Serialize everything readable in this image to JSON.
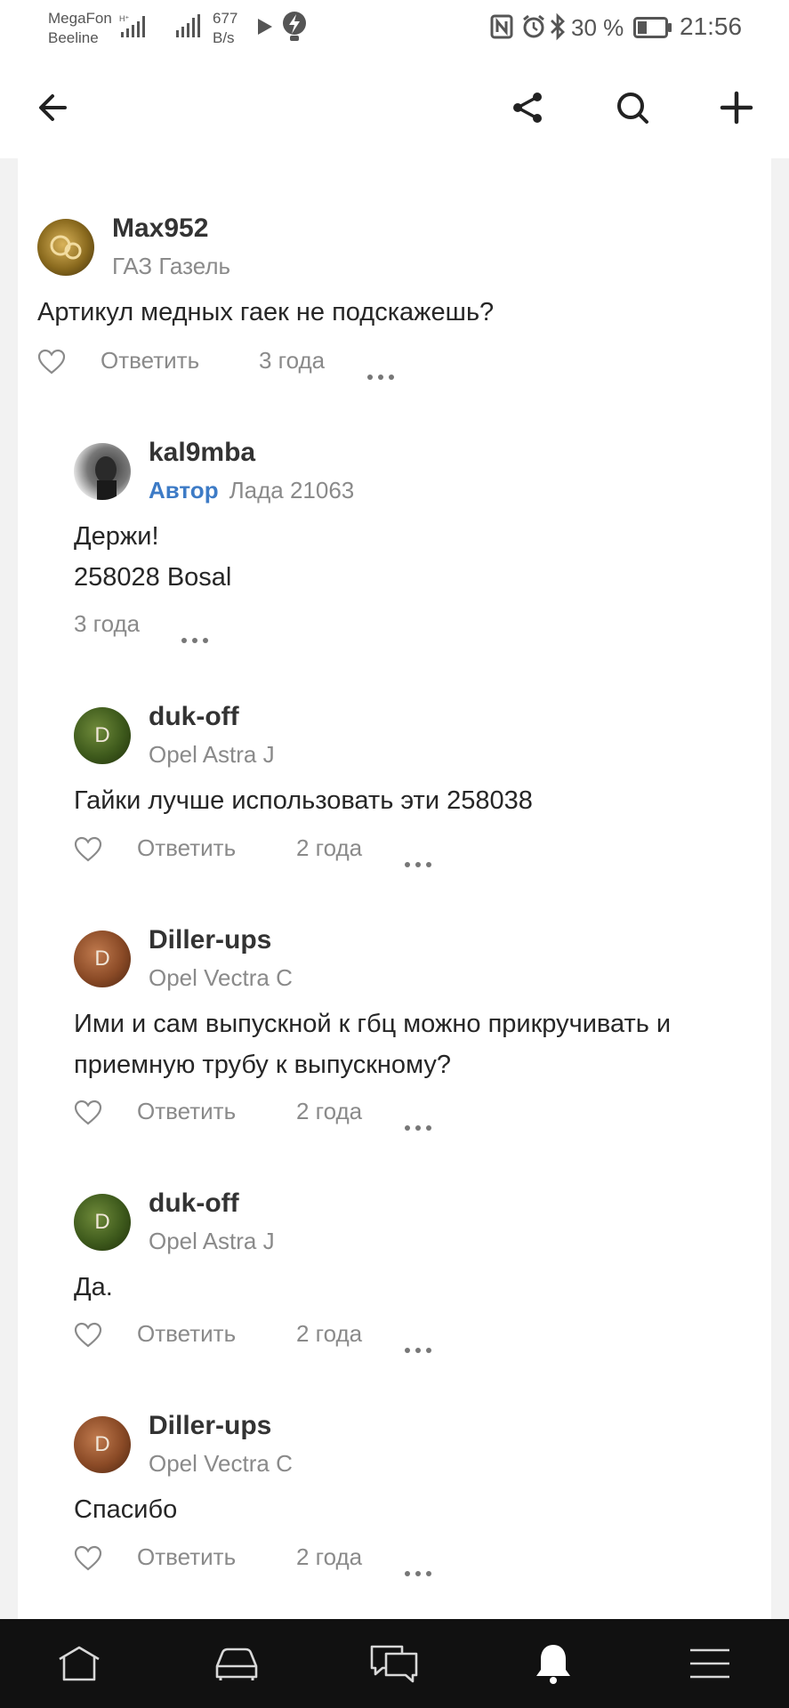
{
  "status_bar": {
    "carrier_1": "MegaFon",
    "carrier_2": "Beeline",
    "speed_value": "677",
    "speed_unit": "B/s",
    "battery": "30 %",
    "time": "21:56"
  },
  "app_bar": {
    "icons": [
      "back-arrow-icon",
      "share-icon",
      "search-icon",
      "plus-icon"
    ]
  },
  "comments": [
    {
      "username": "Max952",
      "car": "ГАЗ Газель",
      "text_lines": [
        "Артикул медных гаек не подскажешь?"
      ],
      "reply_label": "Ответить",
      "time": "3 года",
      "avatar_letter": ""
    },
    {
      "username": "kal9mba",
      "badge": "Автор",
      "car": "Лада 21063",
      "text_lines": [
        "Держи!",
        "258028 Bosal"
      ],
      "time": "3 года",
      "avatar_letter": ""
    },
    {
      "username": "duk-off",
      "car": "Opel Astra J",
      "text_lines": [
        "Гайки лучше использовать эти 258038"
      ],
      "reply_label": "Ответить",
      "time": "2 года",
      "avatar_letter": "D"
    },
    {
      "username": "Diller-ups",
      "car": "Opel Vectra C",
      "text_lines": [
        "Ими и сам выпускной к гбц можно прикручивать и",
        "приемную трубу к выпускному?"
      ],
      "reply_label": "Ответить",
      "time": "2 года",
      "avatar_letter": "D"
    },
    {
      "username": "duk-off",
      "car": "Opel Astra J",
      "text_lines": [
        "Да."
      ],
      "reply_label": "Ответить",
      "time": "2 года",
      "avatar_letter": "D"
    },
    {
      "username": "Diller-ups",
      "car": "Opel Vectra C",
      "text_lines": [
        "Спасибо"
      ],
      "reply_label": "Ответить",
      "time": "2 года",
      "avatar_letter": "D"
    }
  ],
  "bottom_nav": {
    "icons": [
      "home-icon",
      "car-icon",
      "messages-icon",
      "notifications-icon",
      "menu-icon"
    ],
    "active": "notifications-icon"
  },
  "colors": {
    "author_badge": "#3d7bc6",
    "bottom_nav_bg": "#111111",
    "page_bg": "#f2f2f2"
  }
}
